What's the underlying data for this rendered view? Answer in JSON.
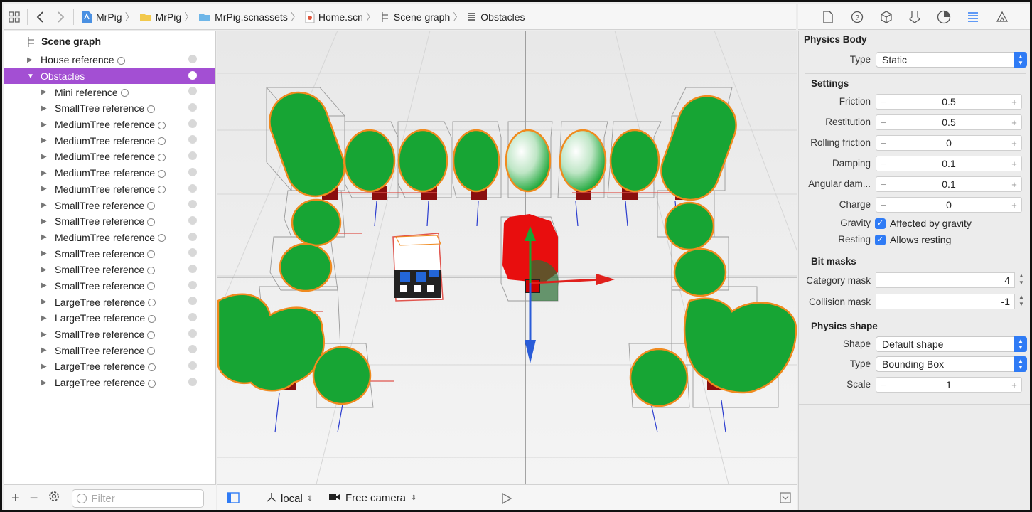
{
  "breadcrumb": [
    "MrPig",
    "MrPig",
    "MrPig.scnassets",
    "Home.scn",
    "Scene graph",
    "Obstacles"
  ],
  "scene_graph": {
    "title": "Scene graph",
    "items": [
      {
        "label": "House reference",
        "level": 0,
        "expanded": false,
        "selected": false
      },
      {
        "label": "Obstacles",
        "level": 0,
        "expanded": true,
        "selected": true
      },
      {
        "label": "Mini reference",
        "level": 1
      },
      {
        "label": "SmallTree reference",
        "level": 1
      },
      {
        "label": "MediumTree reference",
        "level": 1
      },
      {
        "label": "MediumTree reference",
        "level": 1
      },
      {
        "label": "MediumTree reference",
        "level": 1
      },
      {
        "label": "MediumTree reference",
        "level": 1
      },
      {
        "label": "MediumTree reference",
        "level": 1
      },
      {
        "label": "SmallTree reference",
        "level": 1
      },
      {
        "label": "SmallTree reference",
        "level": 1
      },
      {
        "label": "MediumTree reference",
        "level": 1
      },
      {
        "label": "SmallTree reference",
        "level": 1
      },
      {
        "label": "SmallTree reference",
        "level": 1
      },
      {
        "label": "SmallTree reference",
        "level": 1
      },
      {
        "label": "LargeTree reference",
        "level": 1
      },
      {
        "label": "LargeTree reference",
        "level": 1
      },
      {
        "label": "SmallTree reference",
        "level": 1
      },
      {
        "label": "SmallTree reference",
        "level": 1
      },
      {
        "label": "LargeTree reference",
        "level": 1
      },
      {
        "label": "LargeTree reference",
        "level": 1
      }
    ],
    "filter_placeholder": "Filter"
  },
  "viewport": {
    "coord_space": "local",
    "camera": "Free camera"
  },
  "inspector": {
    "physics_body_title": "Physics Body",
    "type_label": "Type",
    "type_value": "Static",
    "settings_title": "Settings",
    "fields": [
      {
        "label": "Friction",
        "value": "0.5"
      },
      {
        "label": "Restitution",
        "value": "0.5"
      },
      {
        "label": "Rolling friction",
        "value": "0"
      },
      {
        "label": "Damping",
        "value": "0.1"
      },
      {
        "label": "Angular dam...",
        "value": "0.1"
      },
      {
        "label": "Charge",
        "value": "0"
      }
    ],
    "gravity_label": "Gravity",
    "gravity_check": "Affected by gravity",
    "resting_label": "Resting",
    "resting_check": "Allows resting",
    "bitmasks_title": "Bit masks",
    "category_label": "Category mask",
    "category_value": "4",
    "collision_label": "Collision mask",
    "collision_value": "-1",
    "shape_title": "Physics shape",
    "shape_label": "Shape",
    "shape_value": "Default shape",
    "shape_type_label": "Type",
    "shape_type_value": "Bounding Box",
    "scale_label": "Scale",
    "scale_value": "1"
  },
  "colors": {
    "selection": "#a34fd3",
    "accent": "#2f7bf5",
    "tree_green": "#17a534",
    "tree_outline": "#f08a1e"
  }
}
